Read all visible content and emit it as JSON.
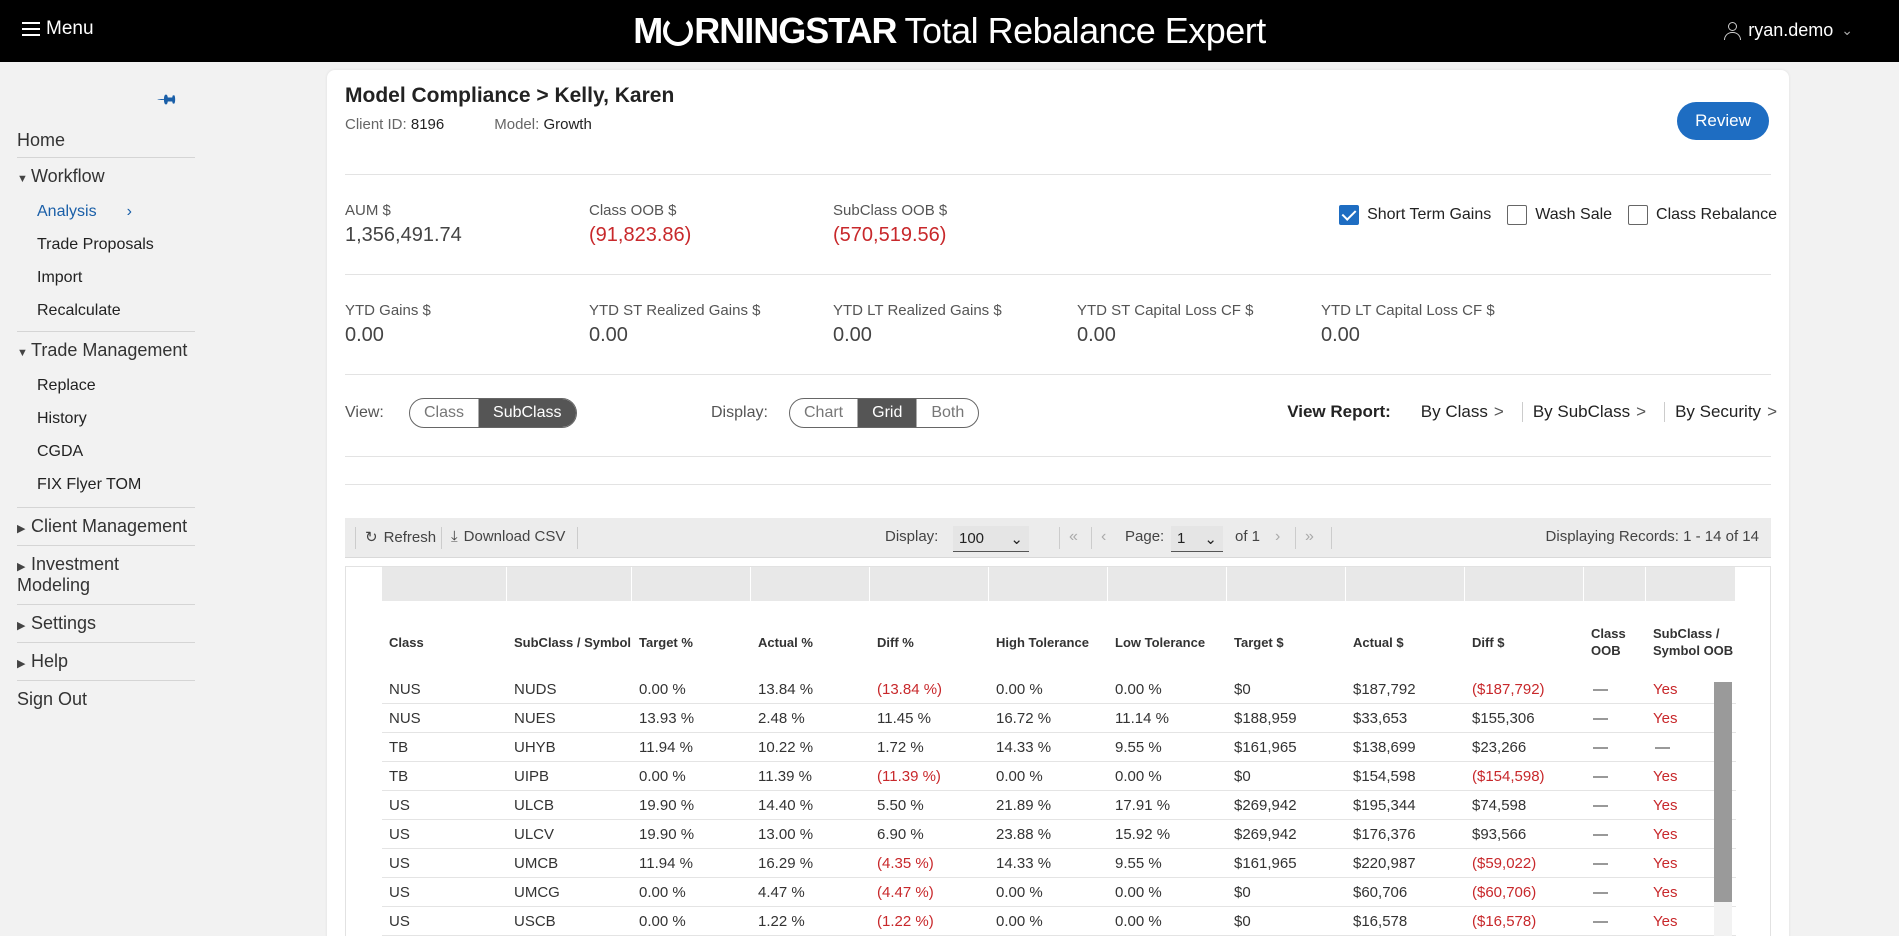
{
  "header": {
    "menu_label": "Menu",
    "brand_left": "M",
    "brand_right": "RNINGSTAR",
    "product": "Total Rebalance Expert",
    "user": "ryan.demo"
  },
  "sidebar": {
    "home": "Home",
    "workflow": "Workflow",
    "workflow_items": [
      "Analysis",
      "Trade Proposals",
      "Import",
      "Recalculate"
    ],
    "trade_management": "Trade Management",
    "trade_items": [
      "Replace",
      "History",
      "CGDA",
      "FIX Flyer TOM"
    ],
    "client_management": "Client Management",
    "investment_modeling": "Investment Modeling",
    "settings": "Settings",
    "help": "Help",
    "sign_out": "Sign Out"
  },
  "page": {
    "title": "Model Compliance > Kelly, Karen",
    "client_id_label": "Client ID:",
    "client_id": "8196",
    "model_label": "Model:",
    "model": "Growth",
    "review": "Review"
  },
  "metrics": {
    "aum_label": "AUM $",
    "aum": "1,356,491.74",
    "class_oob_label": "Class OOB $",
    "class_oob": "(91,823.86)",
    "subclass_oob_label": "SubClass OOB $",
    "subclass_oob": "(570,519.56)",
    "ytd_gains_label": "YTD Gains $",
    "ytd_gains": "0.00",
    "ytd_st_label": "YTD ST Realized Gains $",
    "ytd_st": "0.00",
    "ytd_lt_label": "YTD LT Realized Gains $",
    "ytd_lt": "0.00",
    "ytd_st_loss_label": "YTD ST Capital Loss CF $",
    "ytd_st_loss": "0.00",
    "ytd_lt_loss_label": "YTD LT Capital Loss CF $",
    "ytd_lt_loss": "0.00"
  },
  "options": {
    "short_term_gains": "Short Term Gains",
    "short_term_gains_checked": true,
    "wash_sale": "Wash Sale",
    "wash_sale_checked": false,
    "class_rebalance": "Class Rebalance",
    "class_rebalance_checked": false
  },
  "view": {
    "label": "View:",
    "options": [
      "Class",
      "SubClass"
    ],
    "selected": "SubClass"
  },
  "display": {
    "label": "Display:",
    "options": [
      "Chart",
      "Grid",
      "Both"
    ],
    "selected": "Grid"
  },
  "report": {
    "label": "View Report:",
    "by_class": "By Class",
    "by_subclass": "By SubClass",
    "by_security": "By Security"
  },
  "toolbar": {
    "refresh": "Refresh",
    "download": "Download CSV",
    "display_label": "Display:",
    "page_size": "100",
    "page_label": "Page:",
    "page": "1",
    "of_pages": "of 1",
    "records": "Displaying Records: 1 - 14 of 14"
  },
  "grid": {
    "columns": [
      "Class",
      "SubClass / Symbol",
      "Target %",
      "Actual %",
      "Diff %",
      "High Tolerance",
      "Low Tolerance",
      "Target $",
      "Actual $",
      "Diff $",
      "Class OOB",
      "SubClass / Symbol OOB"
    ],
    "rows": [
      [
        "NUS",
        "NUDS",
        "0.00 %",
        "13.84 %",
        "(13.84 %)",
        "0.00 %",
        "0.00 %",
        "$0",
        "$187,792",
        "($187,792)",
        "—",
        "Yes"
      ],
      [
        "NUS",
        "NUES",
        "13.93 %",
        "2.48 %",
        "11.45 %",
        "16.72 %",
        "11.14 %",
        "$188,959",
        "$33,653",
        "$155,306",
        "—",
        "Yes"
      ],
      [
        "TB",
        "UHYB",
        "11.94 %",
        "10.22 %",
        "1.72 %",
        "14.33 %",
        "9.55 %",
        "$161,965",
        "$138,699",
        "$23,266",
        "—",
        "—"
      ],
      [
        "TB",
        "UIPB",
        "0.00 %",
        "11.39 %",
        "(11.39 %)",
        "0.00 %",
        "0.00 %",
        "$0",
        "$154,598",
        "($154,598)",
        "—",
        "Yes"
      ],
      [
        "US",
        "ULCB",
        "19.90 %",
        "14.40 %",
        "5.50 %",
        "21.89 %",
        "17.91 %",
        "$269,942",
        "$195,344",
        "$74,598",
        "—",
        "Yes"
      ],
      [
        "US",
        "ULCV",
        "19.90 %",
        "13.00 %",
        "6.90 %",
        "23.88 %",
        "15.92 %",
        "$269,942",
        "$176,376",
        "$93,566",
        "—",
        "Yes"
      ],
      [
        "US",
        "UMCB",
        "11.94 %",
        "16.29 %",
        "(4.35 %)",
        "14.33 %",
        "9.55 %",
        "$161,965",
        "$220,987",
        "($59,022)",
        "—",
        "Yes"
      ],
      [
        "US",
        "UMCG",
        "0.00 %",
        "4.47 %",
        "(4.47 %)",
        "0.00 %",
        "0.00 %",
        "$0",
        "$60,706",
        "($60,706)",
        "—",
        "Yes"
      ],
      [
        "US",
        "USCB",
        "0.00 %",
        "1.22 %",
        "(1.22 %)",
        "0.00 %",
        "0.00 %",
        "$0",
        "$16,578",
        "($16,578)",
        "—",
        "Yes"
      ]
    ]
  },
  "colors": {
    "accent": "#1e6dc2",
    "negative": "#c8282b",
    "topbar": "#000000"
  }
}
